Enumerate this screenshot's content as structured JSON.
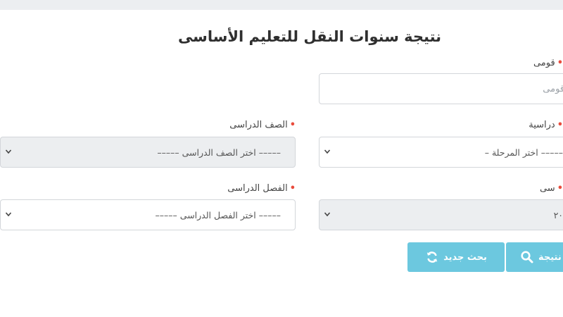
{
  "page": {
    "title": "نتيجة سنوات النقل للتعليم الأساسى"
  },
  "form": {
    "national_id": {
      "label": "قومى",
      "required_mark": "•",
      "placeholder": "قومى"
    },
    "stage": {
      "label": "دراسية",
      "required_mark": "•",
      "selected": "– اختر المرحلة –––––"
    },
    "grade": {
      "label": "الصف الدراسى",
      "required_mark": "•",
      "selected": "––––– اختر الصف الدراسى –––––"
    },
    "year": {
      "label": "سى",
      "required_mark": "•",
      "selected": "٢٠"
    },
    "term": {
      "label": "الفصل الدراسى",
      "required_mark": "•",
      "selected": "––––– اختر الفصل الدراسى –––––"
    }
  },
  "actions": {
    "result_label": "نتيجة",
    "result_icon": "search-icon",
    "new_search_label": "بحث جديد",
    "new_search_icon": "refresh-icon"
  },
  "colors": {
    "button": "#6cc8df",
    "required": "#e94b3c",
    "disabled_field": "#eceef0"
  }
}
